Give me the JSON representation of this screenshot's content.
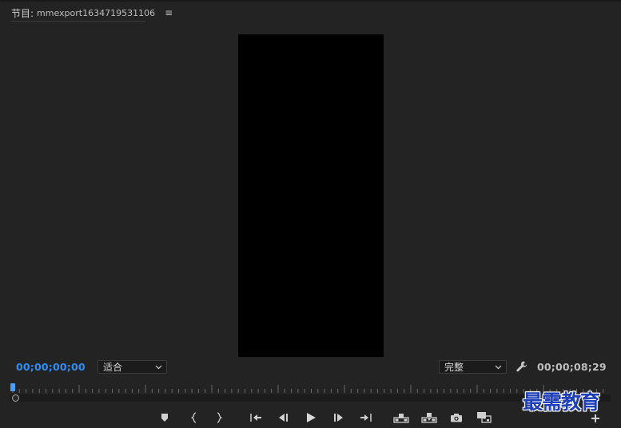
{
  "panel": {
    "label": "节目:",
    "sequence_name": "mmexport1634719531106",
    "menu_icon": "hamburger-menu-icon"
  },
  "timecodes": {
    "current": "00;00;00;00",
    "duration": "00;00;08;29"
  },
  "zoom_dropdown": {
    "selected": "适合"
  },
  "quality_dropdown": {
    "selected": "完整"
  },
  "colors": {
    "background": "#232323",
    "current_timecode": "#2e8ef5",
    "frame": "#000000",
    "watermark": "#1f3fb8"
  },
  "transport": [
    {
      "name": "add-marker-icon"
    },
    {
      "name": "mark-in-icon"
    },
    {
      "name": "mark-out-icon"
    },
    {
      "name": "go-to-in-icon"
    },
    {
      "name": "step-back-icon"
    },
    {
      "name": "play-icon"
    },
    {
      "name": "step-forward-icon"
    },
    {
      "name": "go-to-out-icon"
    },
    {
      "name": "lift-icon"
    },
    {
      "name": "extract-icon"
    },
    {
      "name": "export-frame-icon"
    },
    {
      "name": "comparison-view-icon"
    }
  ],
  "watermark": {
    "text": "最需教育"
  }
}
